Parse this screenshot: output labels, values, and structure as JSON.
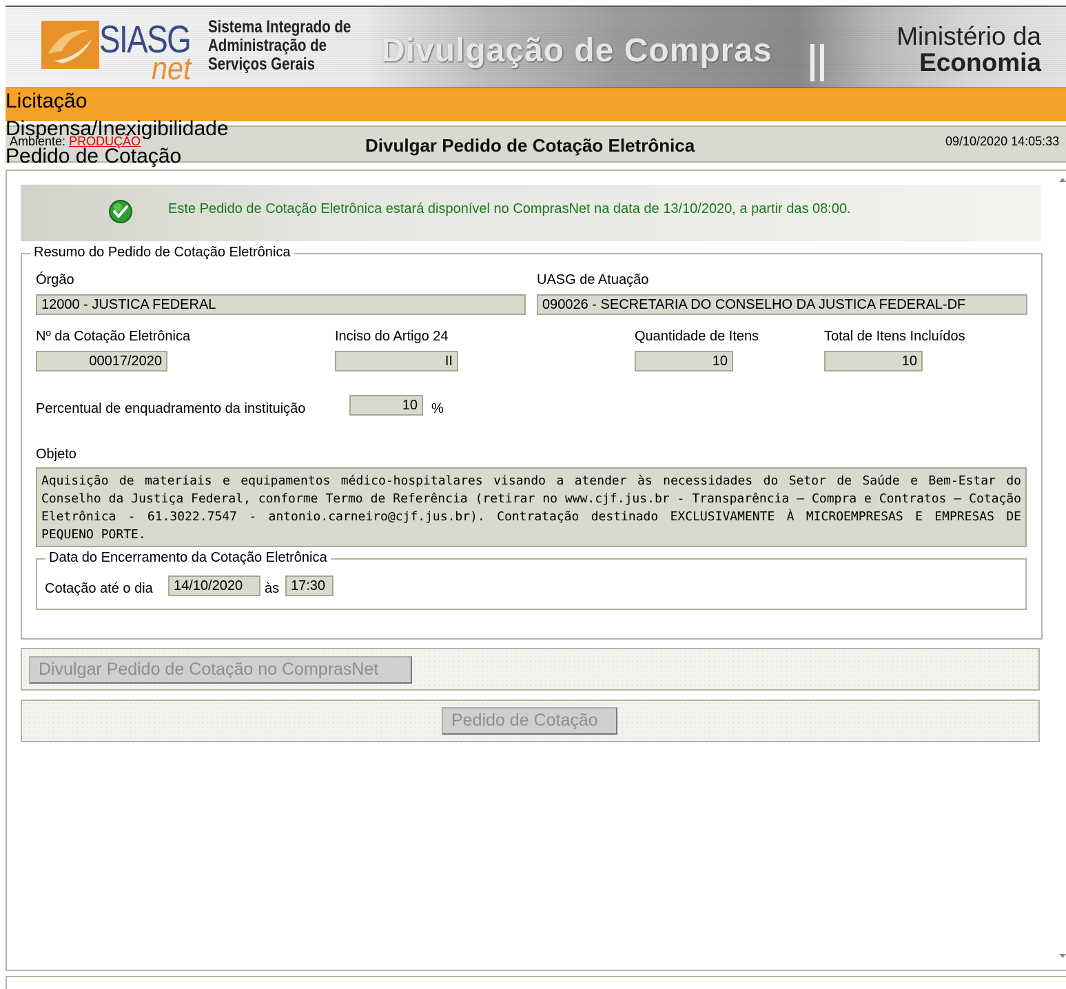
{
  "header": {
    "logo_text": "SIASG",
    "logo_suffix": "net",
    "system_name_line1": "Sistema Integrado de",
    "system_name_line2": "Administração de",
    "system_name_line3": "Serviços Gerais",
    "banner_title": "Divulgação de Compras",
    "ministry_line1": "Ministério da",
    "ministry_line2": "Economia"
  },
  "menu": {
    "items": [
      "Licitação",
      "Dispensa/Inexigibilidade",
      "Pedido de Cotação"
    ]
  },
  "title_bar": {
    "env_label": "Ambiente:",
    "env_value": "PRODUÇÃO",
    "page_title": "Divulgar Pedido de Cotação Eletrônica",
    "datetime": "09/10/2020 14:05:33"
  },
  "message": {
    "text": "Este Pedido de Cotação Eletrônica estará disponível no ComprasNet na data de 13/10/2020, a partir das 08:00."
  },
  "summary": {
    "legend": "Resumo do Pedido de Cotação Eletrônica",
    "orgao_label": "Órgão",
    "orgao_value": "12000 - JUSTICA FEDERAL",
    "uasg_label": "UASG de Atuação",
    "uasg_value": "090026 - SECRETARIA DO CONSELHO DA JUSTICA FEDERAL-DF",
    "cotacao_label": "Nº da Cotação Eletrônica",
    "cotacao_value": "00017/2020",
    "inciso_label": "Inciso do Artigo 24",
    "inciso_value": "II",
    "qtd_label": "Quantidade de Itens",
    "qtd_value": "10",
    "total_label": "Total de Itens Incluídos",
    "total_value": "10",
    "percentual_label": "Percentual de enquadramento da instituição",
    "percentual_value": "10",
    "percent_sign": "%",
    "objeto_label": "Objeto",
    "objeto_value": "Aquisição de materiais e equipamentos médico-hospitalares visando a atender às necessidades do Setor de Saúde e Bem-Estar do Conselho da Justiça Federal, conforme Termo de Referência (retirar no www.cjf.jus.br - Transparência – Compra e Contratos – Cotação Eletrônica -  61.3022.7547 - antonio.carneiro@cjf.jus.br).  Contratação destinado EXCLUSIVAMENTE À MICROEMPRESAS E EMPRESAS DE PEQUENO PORTE."
  },
  "closing": {
    "legend": "Data do Encerramento da Cotação Eletrônica",
    "until_label": "Cotação até o dia",
    "date_value": "14/10/2020",
    "at_label": "às",
    "time_value": "17:30"
  },
  "buttons": {
    "publish_label": "Divulgar Pedido de Cotação no ComprasNet",
    "back_label": "Pedido de Cotação"
  },
  "icons": {
    "success": "check-circle-icon"
  },
  "colors": {
    "menu_bar": "#f5a127",
    "message_text": "#187a18",
    "env_value": "#e00000",
    "field_bg": "#d9d9ce"
  }
}
